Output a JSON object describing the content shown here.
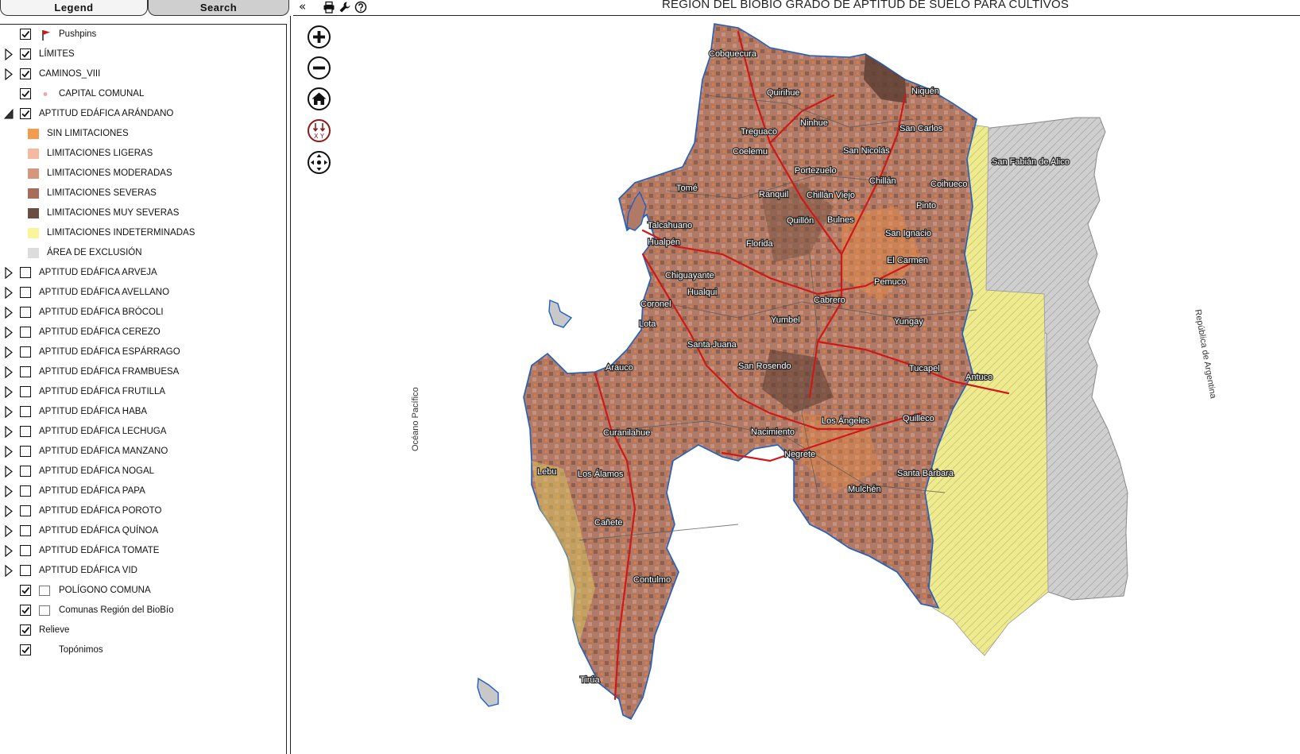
{
  "tabs": {
    "legend": "Legend",
    "search": "Search"
  },
  "toolbar": {
    "collapse_glyph": "«",
    "print_icon": "print-icon",
    "tools_icon": "wrench-icon",
    "help_icon": "help-icon"
  },
  "map": {
    "title": "REGIÓN DEL BIOBÍO GRADO DE APTITUD DE SUELO PARA CULTIVOS",
    "ocean_label": "Océano Pacífico",
    "country_label": "República de Argentina",
    "nav_controls": [
      "zoom-in-icon",
      "zoom-out-icon",
      "home-icon",
      "xy-coordinates-icon",
      "pan-icon"
    ],
    "places": [
      {
        "name": "Cobquecura"
      },
      {
        "name": "Quirihue"
      },
      {
        "name": "Ninhue"
      },
      {
        "name": "Niquén"
      },
      {
        "name": "Treguaco"
      },
      {
        "name": "San Carlos"
      },
      {
        "name": "Coelemu"
      },
      {
        "name": "San Nicolás"
      },
      {
        "name": "San Fabián de Alico"
      },
      {
        "name": "Portezuelo"
      },
      {
        "name": "Chillán"
      },
      {
        "name": "Coihueco"
      },
      {
        "name": "Tomé"
      },
      {
        "name": "Ranquil"
      },
      {
        "name": "Chillán Viejo"
      },
      {
        "name": "Pinto"
      },
      {
        "name": "Quillón"
      },
      {
        "name": "Bulnes"
      },
      {
        "name": "Talcahuano"
      },
      {
        "name": "San Ignacio"
      },
      {
        "name": "Hualpén"
      },
      {
        "name": "Florida"
      },
      {
        "name": "El Carmen"
      },
      {
        "name": "Chiguayante"
      },
      {
        "name": "Pemuco"
      },
      {
        "name": "Hualqui"
      },
      {
        "name": "Cabrero"
      },
      {
        "name": "Coronel"
      },
      {
        "name": "Yumbel"
      },
      {
        "name": "Yungay"
      },
      {
        "name": "Lota"
      },
      {
        "name": "Santa Juana"
      },
      {
        "name": "San Rosendo"
      },
      {
        "name": "Tucapel"
      },
      {
        "name": "Arauco"
      },
      {
        "name": "Antuco"
      },
      {
        "name": "Los Ángeles"
      },
      {
        "name": "Quilleco"
      },
      {
        "name": "Curanilahue"
      },
      {
        "name": "Nacimiento"
      },
      {
        "name": "Negrete"
      },
      {
        "name": "Santa Bárbara"
      },
      {
        "name": "Lebu"
      },
      {
        "name": "Los Álamos"
      },
      {
        "name": "Mulchén"
      },
      {
        "name": "Cañete"
      },
      {
        "name": "Contulmo"
      },
      {
        "name": "Tirúa"
      }
    ]
  },
  "legend": {
    "rows": [
      {
        "label": "Pushpins",
        "checked": true,
        "expander": "none",
        "kind": "pushpin"
      },
      {
        "label": "LÍMITES",
        "checked": true,
        "expander": "collapsed"
      },
      {
        "label": "CAMINOS_VIII",
        "checked": true,
        "expander": "collapsed"
      },
      {
        "label": "CAPITAL COMUNAL",
        "checked": true,
        "expander": "none",
        "kind": "dot"
      },
      {
        "label": "APTITUD EDÁFICA ARÁNDANO",
        "checked": true,
        "expander": "expanded"
      },
      {
        "label": "SIN LIMITACIONES",
        "kind": "swatch",
        "color": "#f39c4e"
      },
      {
        "label": "LIMITACIONES LIGERAS",
        "kind": "swatch",
        "color": "#f6b9a0"
      },
      {
        "label": "LIMITACIONES MODERADAS",
        "kind": "swatch",
        "color": "#d5967c"
      },
      {
        "label": "LIMITACIONES SEVERAS",
        "kind": "swatch",
        "color": "#a86c58"
      },
      {
        "label": "LIMITACIONES MUY SEVERAS",
        "kind": "swatch",
        "color": "#6a4e42"
      },
      {
        "label": "LIMITACIONES INDETERMINADAS",
        "kind": "swatch",
        "color": "#f8f59a"
      },
      {
        "label": "ÁREA DE EXCLUSIÓN",
        "kind": "swatch",
        "color": "#dcdcdc"
      },
      {
        "label": "APTITUD EDÁFICA ARVEJA",
        "checked": false,
        "expander": "collapsed"
      },
      {
        "label": "APTITUD EDÁFICA AVELLANO",
        "checked": false,
        "expander": "collapsed"
      },
      {
        "label": "APTITUD EDÁFICA BRÓCOLI",
        "checked": false,
        "expander": "collapsed"
      },
      {
        "label": "APTITUD EDÁFICA CEREZO",
        "checked": false,
        "expander": "collapsed"
      },
      {
        "label": "APTITUD EDÁFICA ESPÁRRAGO",
        "checked": false,
        "expander": "collapsed"
      },
      {
        "label": "APTITUD EDÁFICA FRAMBUESA",
        "checked": false,
        "expander": "collapsed"
      },
      {
        "label": "APTITUD EDÁFICA FRUTILLA",
        "checked": false,
        "expander": "collapsed"
      },
      {
        "label": "APTITUD EDÁFICA HABA",
        "checked": false,
        "expander": "collapsed"
      },
      {
        "label": "APTITUD EDÁFICA LECHUGA",
        "checked": false,
        "expander": "collapsed"
      },
      {
        "label": "APTITUD EDÁFICA MANZANO",
        "checked": false,
        "expander": "collapsed"
      },
      {
        "label": "APTITUD EDÁFICA NOGAL",
        "checked": false,
        "expander": "collapsed"
      },
      {
        "label": "APTITUD EDÁFICA PAPA",
        "checked": false,
        "expander": "collapsed"
      },
      {
        "label": "APTITUD EDÁFICA POROTO",
        "checked": false,
        "expander": "collapsed"
      },
      {
        "label": "APTITUD EDÁFICA QUÍNOA",
        "checked": false,
        "expander": "collapsed"
      },
      {
        "label": "APTITUD EDÁFICA TOMATE",
        "checked": false,
        "expander": "collapsed"
      },
      {
        "label": "APTITUD EDÁFICA VID",
        "checked": false,
        "expander": "collapsed"
      },
      {
        "label": "POLÍGONO COMUNA",
        "checked": true,
        "expander": "none",
        "kind": "polygon"
      },
      {
        "label": "Comunas Región del BioBío",
        "checked": true,
        "expander": "none",
        "kind": "polygon"
      },
      {
        "label": "Relieve",
        "checked": true,
        "expander": "none"
      },
      {
        "label": "Topónimos",
        "checked": true,
        "expander": "none",
        "kind": "indent"
      }
    ]
  }
}
